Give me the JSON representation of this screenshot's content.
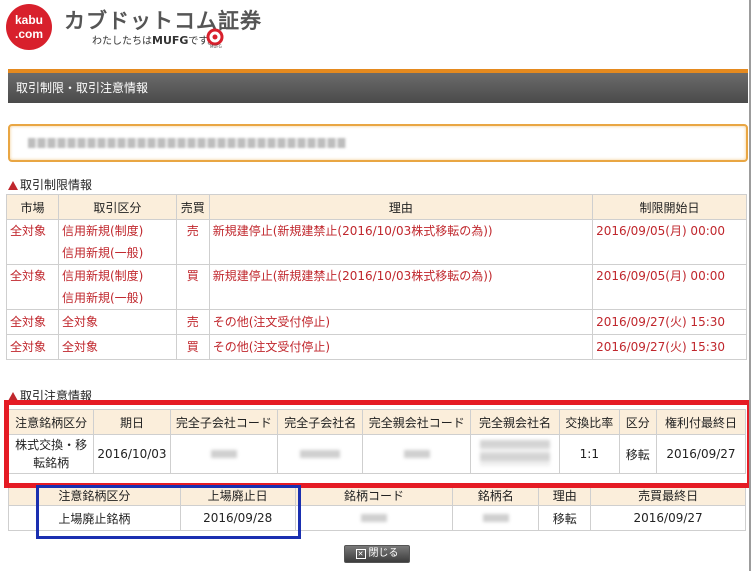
{
  "header": {
    "logo_line1": "kabu",
    "logo_line2": ".com",
    "brand": "カブドットコム証券",
    "tagline_prefix": "わたしたちは",
    "tagline_bold": "MUFG",
    "tagline_suffix": "です。",
    "mufg_label": "MUFG"
  },
  "page_title": "取引制限・取引注意情報",
  "restriction": {
    "section_title": "取引制限情報",
    "headers": [
      "市場",
      "取引区分",
      "売買",
      "理由",
      "制限開始日"
    ],
    "rows": [
      {
        "market": "全対象",
        "kubun1": "信用新規(制度)",
        "kubun2": "信用新規(一般)",
        "side": "売",
        "reason": "新規建停止(新規建禁止(2016/10/03株式移転の為))",
        "start": "2016/09/05(月) 00:00"
      },
      {
        "market": "全対象",
        "kubun1": "信用新規(制度)",
        "kubun2": "信用新規(一般)",
        "side": "買",
        "reason": "新規建停止(新規建禁止(2016/10/03株式移転の為))",
        "start": "2016/09/05(月) 00:00"
      },
      {
        "market": "全対象",
        "kubun1": "全対象",
        "kubun2": "",
        "side": "売",
        "reason": "その他(注文受付停止)",
        "start": "2016/09/27(火) 15:30"
      },
      {
        "market": "全対象",
        "kubun1": "全対象",
        "kubun2": "",
        "side": "買",
        "reason": "その他(注文受付停止)",
        "start": "2016/09/27(火) 15:30"
      }
    ]
  },
  "caution": {
    "section_title": "取引注意情報",
    "headers": [
      "注意銘柄区分",
      "期日",
      "完全子会社コード",
      "完全子会社名",
      "完全親会社コード",
      "完全親会社名",
      "交換比率",
      "区分",
      "権利付最終日"
    ],
    "row": {
      "kubun": "株式交換・移転銘柄",
      "date": "2016/10/03",
      "ratio": "1:1",
      "type": "移転",
      "last_day": "2016/09/27"
    }
  },
  "delist": {
    "headers": [
      "注意銘柄区分",
      "上場廃止日",
      "銘柄コード",
      "銘柄名",
      "理由",
      "売買最終日"
    ],
    "row": {
      "kubun": "上場廃止銘柄",
      "date": "2016/09/28",
      "reason": "移転",
      "last_day": "2016/09/27"
    }
  },
  "close_button": {
    "icon": "close-icon",
    "label": "閉じる"
  },
  "colors": {
    "accent_orange": "#e58a1f",
    "warning_red": "#c0272d",
    "highlight_red": "#e51b24",
    "highlight_blue": "#1a2fb0",
    "header_bg": "#fbeedb"
  }
}
